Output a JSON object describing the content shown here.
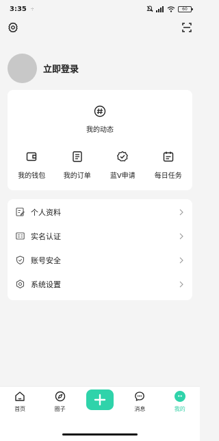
{
  "status_bar": {
    "time": "3:35",
    "signal_dots": "·:·",
    "battery": "60"
  },
  "profile": {
    "login_text": "立即登录"
  },
  "dynamic": {
    "label": "我的动态",
    "icon": "hash-icon"
  },
  "grid": [
    {
      "label": "我的钱包",
      "icon": "wallet-icon"
    },
    {
      "label": "我的订单",
      "icon": "order-icon"
    },
    {
      "label": "蓝V申请",
      "icon": "badge-check-icon"
    },
    {
      "label": "每日任务",
      "icon": "calendar-icon"
    }
  ],
  "menu": [
    {
      "label": "个人资料",
      "icon": "profile-edit-icon"
    },
    {
      "label": "实名认证",
      "icon": "id-card-icon"
    },
    {
      "label": "账号安全",
      "icon": "shield-icon"
    },
    {
      "label": "系统设置",
      "icon": "settings-icon"
    }
  ],
  "tabs": [
    {
      "label": "首页",
      "icon": "home-icon"
    },
    {
      "label": "圈子",
      "icon": "compass-icon"
    },
    {
      "label": "",
      "icon": "plus-icon"
    },
    {
      "label": "消息",
      "icon": "message-icon"
    },
    {
      "label": "我的",
      "icon": "me-icon",
      "active": true
    }
  ],
  "colors": {
    "accent": "#2fd3aa",
    "background": "#f4f4f4",
    "card": "#ffffff"
  }
}
